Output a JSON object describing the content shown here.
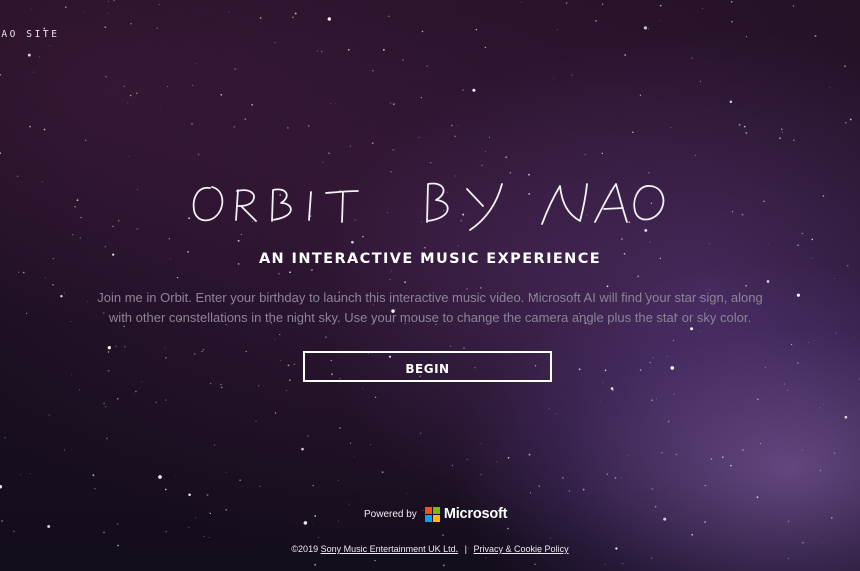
{
  "nav": {
    "site_link": "NAO SITE"
  },
  "hero": {
    "title": "Orbit by NAO",
    "subtitle": "AN INTERACTIVE MUSIC EXPERIENCE",
    "description": "Join me in Orbit. Enter your birthday to launch this interactive music video. Microsoft AI will find your star sign, along with other constellations in the night sky. Use your mouse to change the camera angle plus the star or sky color.",
    "begin_label": "BEGIN"
  },
  "powered_by": {
    "label": "Powered by",
    "brand": "Microsoft",
    "logo_colors": [
      "#f25022",
      "#7fba00",
      "#00a4ef",
      "#ffb900"
    ]
  },
  "footer": {
    "copyright": "©2019",
    "company_link": "Sony Music Entertainment UK Ltd.",
    "separator": "|",
    "privacy_link": "Privacy & Cookie Policy"
  },
  "colors": {
    "background": "#1b0f22",
    "nebula": "#8a66b4",
    "description_text": "#8d8398",
    "button_border": "#ffffff"
  }
}
